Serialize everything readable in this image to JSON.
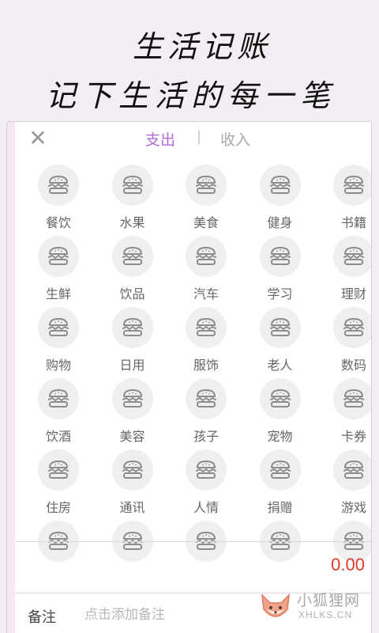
{
  "promo": {
    "line1": "生活记账",
    "line2": "记下生活的每一笔"
  },
  "topbar": {
    "close_icon": "close-icon",
    "tabs": [
      {
        "label": "支出",
        "active": true
      },
      {
        "label": "收入",
        "active": false
      }
    ],
    "separator": "|"
  },
  "categories": [
    {
      "label": "餐饮",
      "icon": "burger-icon"
    },
    {
      "label": "水果",
      "icon": "burger-icon"
    },
    {
      "label": "美食",
      "icon": "burger-icon"
    },
    {
      "label": "健身",
      "icon": "burger-icon"
    },
    {
      "label": "书籍",
      "icon": "burger-icon"
    },
    {
      "label": "生鲜",
      "icon": "burger-icon"
    },
    {
      "label": "饮品",
      "icon": "burger-icon"
    },
    {
      "label": "汽车",
      "icon": "burger-icon"
    },
    {
      "label": "学习",
      "icon": "burger-icon"
    },
    {
      "label": "理财",
      "icon": "burger-icon"
    },
    {
      "label": "购物",
      "icon": "burger-icon"
    },
    {
      "label": "日用",
      "icon": "burger-icon"
    },
    {
      "label": "服饰",
      "icon": "burger-icon"
    },
    {
      "label": "老人",
      "icon": "burger-icon"
    },
    {
      "label": "数码",
      "icon": "burger-icon"
    },
    {
      "label": "饮酒",
      "icon": "burger-icon"
    },
    {
      "label": "美容",
      "icon": "burger-icon"
    },
    {
      "label": "孩子",
      "icon": "burger-icon"
    },
    {
      "label": "宠物",
      "icon": "burger-icon"
    },
    {
      "label": "卡券",
      "icon": "burger-icon"
    },
    {
      "label": "住房",
      "icon": "burger-icon"
    },
    {
      "label": "通讯",
      "icon": "burger-icon"
    },
    {
      "label": "人情",
      "icon": "burger-icon"
    },
    {
      "label": "捐赠",
      "icon": "burger-icon"
    },
    {
      "label": "游戏",
      "icon": "burger-icon"
    },
    {
      "label": "",
      "icon": "burger-icon"
    },
    {
      "label": "",
      "icon": "burger-icon"
    },
    {
      "label": "",
      "icon": "burger-icon"
    },
    {
      "label": "",
      "icon": "burger-icon"
    },
    {
      "label": "",
      "icon": "burger-icon"
    }
  ],
  "amount": {
    "value": "0.00"
  },
  "note": {
    "label": "备注",
    "placeholder": "点击添加备注"
  },
  "watermark": {
    "name": "小狐狸网",
    "domain": "XHLKS.CN"
  },
  "colors": {
    "accent": "#b06ad6",
    "amount": "#e0392b",
    "background": "#f3eef3"
  }
}
